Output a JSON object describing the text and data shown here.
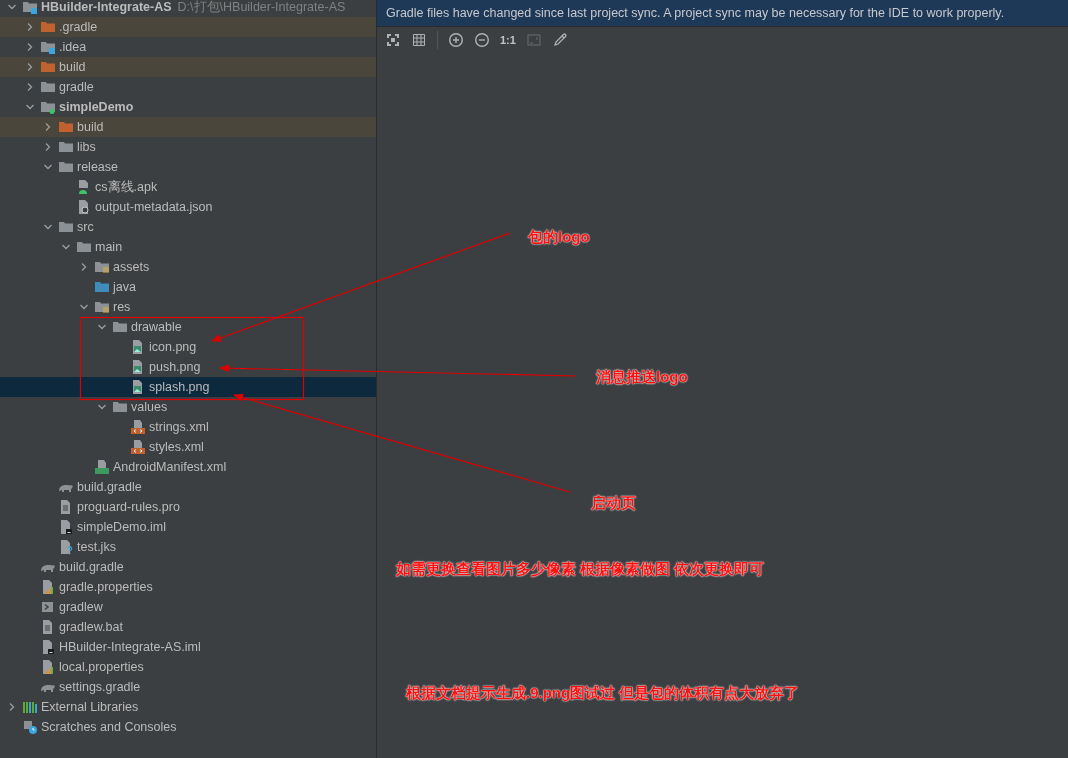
{
  "project_tree": [
    {
      "label": "HBuilder-Integrate-AS",
      "path": "D:\\打包\\HBuilder-Integrate-AS",
      "kind": "folder-ide",
      "bold": true,
      "expanded": true,
      "excluded": false,
      "selected": false,
      "children": [
        {
          "label": ".gradle",
          "kind": "folder-excluded",
          "expanded": false,
          "excluded": true,
          "selected": false
        },
        {
          "label": ".idea",
          "kind": "folder-ide",
          "expanded": false,
          "excluded": false,
          "selected": false
        },
        {
          "label": "build",
          "kind": "folder-excluded",
          "expanded": false,
          "excluded": true,
          "selected": false
        },
        {
          "label": "gradle",
          "kind": "folder",
          "expanded": false,
          "excluded": false,
          "selected": false
        },
        {
          "label": "simpleDemo",
          "kind": "folder-module",
          "bold": true,
          "expanded": true,
          "excluded": false,
          "selected": false,
          "children": [
            {
              "label": "build",
              "kind": "folder-excluded",
              "expanded": false,
              "excluded": true,
              "selected": false
            },
            {
              "label": "libs",
              "kind": "folder",
              "expanded": false,
              "excluded": false,
              "selected": false
            },
            {
              "label": "release",
              "kind": "folder",
              "expanded": true,
              "excluded": false,
              "selected": false,
              "children": [
                {
                  "label": "cs离线.apk",
                  "kind": "file-apk",
                  "excluded": false,
                  "selected": false
                },
                {
                  "label": "output-metadata.json",
                  "kind": "file-json",
                  "excluded": false,
                  "selected": false
                }
              ]
            },
            {
              "label": "src",
              "kind": "folder",
              "expanded": true,
              "excluded": false,
              "selected": false,
              "children": [
                {
                  "label": "main",
                  "kind": "folder",
                  "expanded": true,
                  "excluded": false,
                  "selected": false,
                  "children": [
                    {
                      "label": "assets",
                      "kind": "folder-resource",
                      "expanded": false,
                      "excluded": false,
                      "selected": false
                    },
                    {
                      "label": "java",
                      "kind": "folder-source",
                      "excluded": false,
                      "selected": false
                    },
                    {
                      "label": "res",
                      "kind": "folder-resource",
                      "expanded": true,
                      "excluded": false,
                      "selected": false,
                      "children": [
                        {
                          "label": "drawable",
                          "kind": "folder",
                          "expanded": true,
                          "excluded": false,
                          "selected": false,
                          "children": [
                            {
                              "label": "icon.png",
                              "kind": "file-image",
                              "excluded": false,
                              "selected": false
                            },
                            {
                              "label": "push.png",
                              "kind": "file-image",
                              "excluded": false,
                              "selected": false
                            },
                            {
                              "label": "splash.png",
                              "kind": "file-image",
                              "excluded": false,
                              "selected": true
                            }
                          ]
                        },
                        {
                          "label": "values",
                          "kind": "folder",
                          "expanded": true,
                          "excluded": false,
                          "selected": false,
                          "children": [
                            {
                              "label": "strings.xml",
                              "kind": "file-xml",
                              "excluded": false,
                              "selected": false
                            },
                            {
                              "label": "styles.xml",
                              "kind": "file-xml",
                              "excluded": false,
                              "selected": false
                            }
                          ]
                        }
                      ]
                    },
                    {
                      "label": "AndroidManifest.xml",
                      "kind": "file-manifest",
                      "excluded": false,
                      "selected": false
                    }
                  ]
                }
              ]
            },
            {
              "label": "build.gradle",
              "kind": "file-gradle",
              "excluded": false,
              "selected": false
            },
            {
              "label": "proguard-rules.pro",
              "kind": "file-text",
              "excluded": false,
              "selected": false
            },
            {
              "label": "simpleDemo.iml",
              "kind": "file-iml",
              "excluded": false,
              "selected": false
            },
            {
              "label": "test.jks",
              "kind": "file-unknown",
              "excluded": false,
              "selected": false
            }
          ]
        },
        {
          "label": "build.gradle",
          "kind": "file-gradle",
          "excluded": false,
          "selected": false
        },
        {
          "label": "gradle.properties",
          "kind": "file-properties",
          "excluded": false,
          "selected": false
        },
        {
          "label": "gradlew",
          "kind": "file-shell",
          "excluded": false,
          "selected": false
        },
        {
          "label": "gradlew.bat",
          "kind": "file-text",
          "excluded": false,
          "selected": false
        },
        {
          "label": "HBuilder-Integrate-AS.iml",
          "kind": "file-iml",
          "excluded": false,
          "selected": false
        },
        {
          "label": "local.properties",
          "kind": "file-properties",
          "excluded": false,
          "selected": false
        },
        {
          "label": "settings.gradle",
          "kind": "file-gradle",
          "excluded": false,
          "selected": false
        }
      ]
    },
    {
      "label": "External Libraries",
      "kind": "libraries",
      "expanded": false,
      "excluded": false,
      "selected": false
    },
    {
      "label": "Scratches and Consoles",
      "kind": "scratches",
      "excluded": false,
      "selected": false
    }
  ],
  "notification": {
    "text": "Gradle files have changed since last project sync. A project sync may be necessary for the IDE to work properly."
  },
  "image_toolbar": {
    "actual_size_label": "1:1"
  },
  "annotations": [
    {
      "text": "包的logo"
    },
    {
      "text": "消息推送logo"
    },
    {
      "text": "启动页"
    },
    {
      "text": "如需更换查看图片多少像素 根据像素做图 依次更换即可"
    },
    {
      "text": "根据文档提示生成.9.png图试过 但是包的体积有点大放弃了"
    }
  ]
}
